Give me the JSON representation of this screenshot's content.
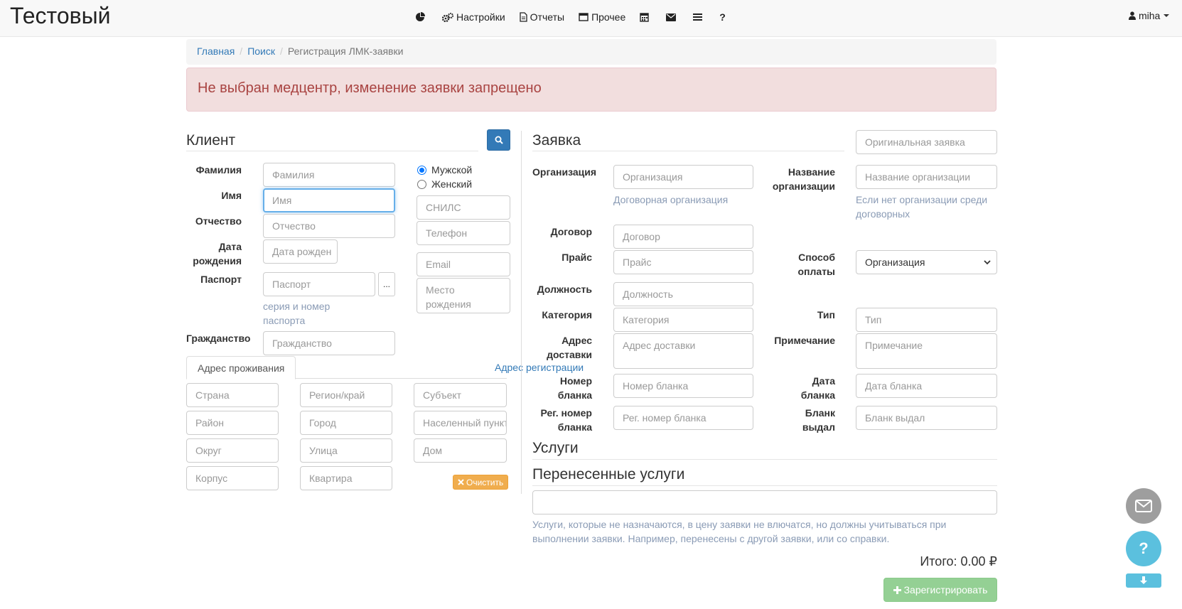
{
  "navbar": {
    "brand": "Тестовый",
    "items": [
      {
        "icon": "pie-chart-icon",
        "label": ""
      },
      {
        "icon": "gears-icon",
        "label": "Настройки"
      },
      {
        "icon": "file-icon",
        "label": "Отчеты"
      },
      {
        "icon": "window-icon",
        "label": "Прочее"
      },
      {
        "icon": "calendar-icon",
        "label": ""
      },
      {
        "icon": "envelope-icon",
        "label": ""
      },
      {
        "icon": "list-icon",
        "label": ""
      },
      {
        "icon": "question-icon",
        "label": "?"
      }
    ],
    "user": "miha"
  },
  "breadcrumb": {
    "home": "Главная",
    "search": "Поиск",
    "current": "Регистрация ЛМК-заявки"
  },
  "alert": "Не выбран медцентр, изменение заявки запрещено",
  "client": {
    "title": "Клиент",
    "surname_label": "Фамилия",
    "surname_placeholder": "Фамилия",
    "name_label": "Имя",
    "name_placeholder": "Имя",
    "patronymic_label": "Отчество",
    "patronymic_placeholder": "Отчество",
    "birth_label_1": "Дата",
    "birth_label_2": "рождения",
    "birth_placeholder": "Дата рожден",
    "passport_label": "Паспорт",
    "passport_placeholder": "Паспорт",
    "passport_dots": "...",
    "passport_help_1": "серия и номер",
    "passport_help_2": "паспорта",
    "citizenship_label": "Гражданство",
    "citizenship_placeholder": "Гражданство",
    "gender_male": "Мужской",
    "gender_female": "Женский",
    "gender_selected": "male",
    "snils_placeholder": "СНИЛС",
    "phone_placeholder": "Телефон",
    "email_placeholder": "Email",
    "birthplace_placeholder": "Место рождения"
  },
  "address": {
    "tab_live": "Адрес проживания",
    "tab_reg": "Адрес регистрации",
    "country": "Страна",
    "region": "Регион/край",
    "subject": "Субъект",
    "district": "Район",
    "city": "Город",
    "settlement": "Населенный пункт",
    "okrug": "Округ",
    "street": "Улица",
    "house": "Дом",
    "building": "Корпус",
    "apartment": "Квартира",
    "clear_button": "Очистить"
  },
  "request": {
    "title": "Заявка",
    "original_placeholder": "Оригинальная заявка",
    "org_label": "Организация",
    "org_placeholder": "Организация",
    "org_help": "Договорная организация",
    "org_name_label_1": "Название",
    "org_name_label_2": "организации",
    "org_name_placeholder": "Название организации",
    "org_name_help_1": "Если нет организации среди",
    "org_name_help_2": "договорных",
    "contract_label": "Договор",
    "contract_placeholder": "Договор",
    "price_label": "Прайс",
    "price_placeholder": "Прайс",
    "payment_label_1": "Способ",
    "payment_label_2": "оплаты",
    "payment_value": "Организация",
    "position_label": "Должность",
    "position_placeholder": "Должность",
    "category_label": "Категория",
    "category_placeholder": "Категория",
    "type_label": "Тип",
    "type_placeholder": "Тип",
    "delivery_label_1": "Адрес",
    "delivery_label_2": "доставки",
    "delivery_placeholder": "Адрес доставки",
    "note_label": "Примечание",
    "note_placeholder": "Примечание",
    "form_number_label_1": "Номер",
    "form_number_label_2": "бланка",
    "form_number_placeholder": "Номер бланка",
    "form_date_label_1": "Дата",
    "form_date_label_2": "бланка",
    "form_date_placeholder": "Дата бланка",
    "reg_number_label_1": "Рег. номер",
    "reg_number_label_2": "бланка",
    "reg_number_placeholder": "Рег. номер бланка",
    "issued_label_1": "Бланк",
    "issued_label_2": "выдал",
    "issued_placeholder": "Бланк выдал"
  },
  "services": {
    "title": "Услуги",
    "transferred_title": "Перенесенные услуги",
    "transferred_value": "",
    "help_1": "Услуги, которые не назначаются, в цену заявки не влючатся, но должны учитываться при",
    "help_2": "выполнении заявки. Например, перенесены с другой заявки, или со справки."
  },
  "total": "Итого: 0.00 ₽",
  "register_button": "Зарегистрировать",
  "colors": {
    "primary": "#337ab7",
    "alert_bg": "#f2dede",
    "alert_text": "#a94442",
    "warning": "#f0ad4e",
    "success": "#5cb85c",
    "info": "#5bc0de"
  }
}
